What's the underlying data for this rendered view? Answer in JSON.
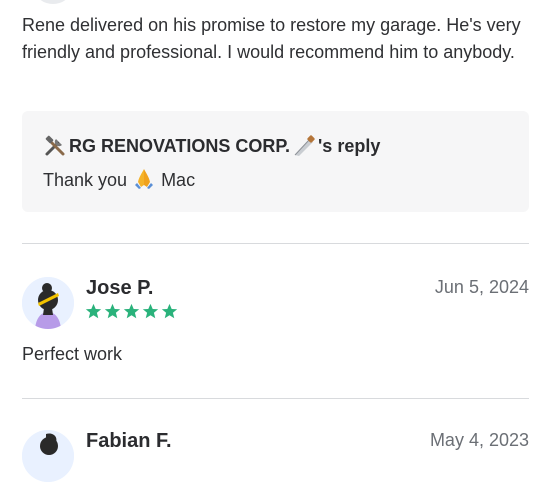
{
  "review1": {
    "text": "Rene delivered on his promise to restore my garage. He's very friendly and professional. I would recommend him to anybody.",
    "reply": {
      "business_name": "RG RENOVATIONS CORP.",
      "reply_suffix": "'s reply",
      "text_before": "Thank you",
      "text_after": "Mac"
    }
  },
  "review2": {
    "name": "Jose P.",
    "date": "Jun 5, 2024",
    "rating": 5,
    "text": "Perfect work"
  },
  "review3": {
    "name": "Fabian F.",
    "date": "May 4, 2023"
  },
  "colors": {
    "star": "#2ab27b",
    "reply_bg": "#f6f6f7",
    "divider": "#d8dadd"
  }
}
